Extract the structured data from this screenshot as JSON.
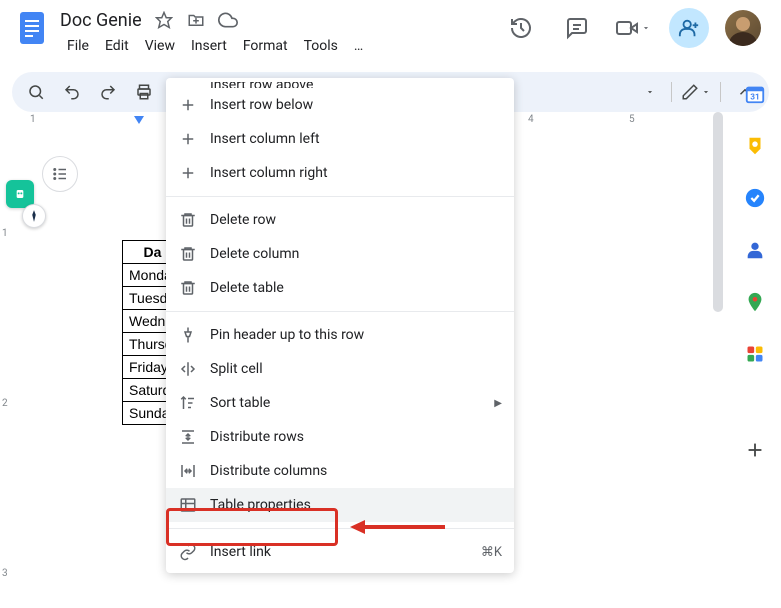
{
  "header": {
    "title": "Doc Genie",
    "menus": [
      "File",
      "Edit",
      "View",
      "Insert",
      "Format",
      "Tools",
      "…"
    ]
  },
  "ruler": {
    "marks": [
      "1",
      "4",
      "5"
    ]
  },
  "vruler": {
    "marks": [
      "1",
      "2",
      "3"
    ]
  },
  "table": {
    "header": "Da",
    "rows": [
      "Monda",
      "Tuesd",
      "Wedn",
      "Thursd",
      "Friday",
      "Saturd",
      "Sunda"
    ]
  },
  "context_menu": {
    "cut_item": "Insert row above",
    "groups": [
      [
        {
          "icon": "plus",
          "label": "Insert row below"
        },
        {
          "icon": "plus",
          "label": "Insert column left"
        },
        {
          "icon": "plus",
          "label": "Insert column right"
        }
      ],
      [
        {
          "icon": "trash",
          "label": "Delete row"
        },
        {
          "icon": "trash",
          "label": "Delete column"
        },
        {
          "icon": "trash",
          "label": "Delete table"
        }
      ],
      [
        {
          "icon": "pin",
          "label": "Pin header up to this row"
        },
        {
          "icon": "split",
          "label": "Split cell"
        },
        {
          "icon": "sort",
          "label": "Sort table",
          "submenu": true
        },
        {
          "icon": "dist-rows",
          "label": "Distribute rows"
        },
        {
          "icon": "dist-cols",
          "label": "Distribute columns"
        },
        {
          "icon": "table",
          "label": "Table properties",
          "highlighted": true
        }
      ],
      [
        {
          "icon": "link",
          "label": "Insert link",
          "shortcut": "⌘K"
        }
      ]
    ]
  }
}
